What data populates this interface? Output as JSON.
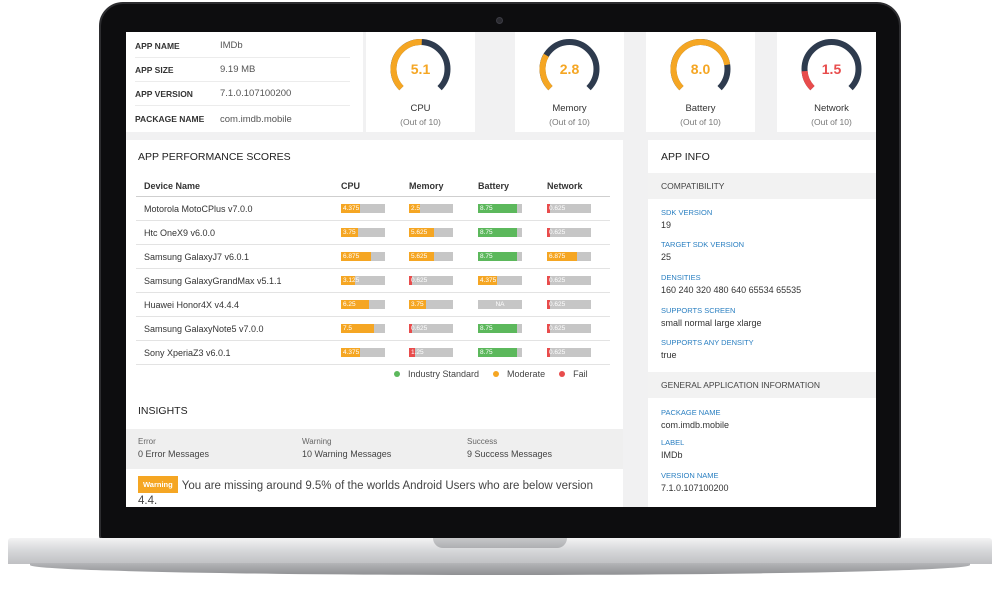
{
  "app_info": [
    {
      "key": "APP NAME",
      "value": "IMDb"
    },
    {
      "key": "APP SIZE",
      "value": "9.19 MB"
    },
    {
      "key": "APP VERSION",
      "value": "7.1.0.107100200"
    },
    {
      "key": "PACKAGE NAME",
      "value": "com.imdb.mobile"
    }
  ],
  "gauges": [
    {
      "label": "CPU",
      "value": "5.1",
      "score": 5.1,
      "sub": "(Out of 10)",
      "color": "#f5a623"
    },
    {
      "label": "Memory",
      "value": "2.8",
      "score": 2.8,
      "sub": "(Out of 10)",
      "color": "#f5a623"
    },
    {
      "label": "Battery",
      "value": "8.0",
      "score": 8.0,
      "sub": "(Out of 10)",
      "color": "#f5a623"
    },
    {
      "label": "Network",
      "value": "1.5",
      "score": 1.5,
      "sub": "(Out of 10)",
      "color": "#e84c4c"
    }
  ],
  "colors": {
    "green": "#5cb85c",
    "orange": "#f5a623",
    "red": "#e84c4c",
    "track": "#c6c6c6",
    "gauge_track": "#2e3b4e"
  },
  "performance": {
    "title": "APP PERFORMANCE SCORES",
    "columns": [
      "Device Name",
      "CPU",
      "Memory",
      "Battery",
      "Network"
    ],
    "rows": [
      {
        "device": "Motorola MotoCPlus v7.0.0",
        "scores": [
          [
            "4.375",
            "orange",
            0.44
          ],
          [
            "2.5",
            "orange",
            0.25
          ],
          [
            "8.75",
            "green",
            0.88
          ],
          [
            "0.625",
            "red",
            0.06
          ]
        ]
      },
      {
        "device": "Htc OneX9 v6.0.0",
        "scores": [
          [
            "3.75",
            "orange",
            0.38
          ],
          [
            "5.625",
            "orange",
            0.56
          ],
          [
            "8.75",
            "green",
            0.88
          ],
          [
            "0.625",
            "red",
            0.06
          ]
        ]
      },
      {
        "device": "Samsung GalaxyJ7 v6.0.1",
        "scores": [
          [
            "6.875",
            "orange",
            0.69
          ],
          [
            "5.625",
            "orange",
            0.56
          ],
          [
            "8.75",
            "green",
            0.88
          ],
          [
            "6.875",
            "orange",
            0.69
          ]
        ]
      },
      {
        "device": "Samsung GalaxyGrandMax v5.1.1",
        "scores": [
          [
            "3.125",
            "orange",
            0.31
          ],
          [
            "0.625",
            "red",
            0.06
          ],
          [
            "4.375",
            "orange",
            0.44
          ],
          [
            "0.625",
            "red",
            0.06
          ]
        ]
      },
      {
        "device": "Huawei Honor4X v4.4.4",
        "scores": [
          [
            "6.25",
            "orange",
            0.63
          ],
          [
            "3.75",
            "orange",
            0.38
          ],
          [
            "NA",
            "na",
            0
          ],
          [
            "0.625",
            "red",
            0.06
          ]
        ]
      },
      {
        "device": "Samsung GalaxyNote5 v7.0.0",
        "scores": [
          [
            "7.5",
            "orange",
            0.75
          ],
          [
            "0.625",
            "red",
            0.06
          ],
          [
            "8.75",
            "green",
            0.88
          ],
          [
            "0.625",
            "red",
            0.06
          ]
        ]
      },
      {
        "device": "Sony XperiaZ3 v6.0.1",
        "scores": [
          [
            "4.375",
            "orange",
            0.44
          ],
          [
            "1.25",
            "red",
            0.13
          ],
          [
            "8.75",
            "green",
            0.88
          ],
          [
            "0.625",
            "red",
            0.06
          ]
        ]
      }
    ],
    "legend": [
      {
        "label": "Industry Standard",
        "color": "#5cb85c"
      },
      {
        "label": "Moderate",
        "color": "#f5a623"
      },
      {
        "label": "Fail",
        "color": "#e84c4c"
      }
    ]
  },
  "insights": {
    "title": "INSIGHTS",
    "error_label": "Error",
    "error_value": "0 Error Messages",
    "warning_label": "Warning",
    "warning_value": "10 Warning Messages",
    "success_label": "Success",
    "success_value": "9 Success Messages",
    "badge": "Warning",
    "message": "You are missing around 9.5% of the worlds Android Users who are below version 4.4."
  },
  "sidebar": {
    "title": "APP INFO",
    "compat_title": "COMPATIBILITY",
    "sdk_version_label": "SDK VERSION",
    "sdk_version": "19",
    "target_sdk_label": "TARGET SDK VERSION",
    "target_sdk": "25",
    "densities_label": "DENSITIES",
    "densities": "160 240 320 480 640 65534 65535",
    "screens_label": "SUPPORTS SCREEN",
    "screens": "small normal large xlarge",
    "any_density_label": "SUPPORTS ANY DENSITY",
    "any_density": "true",
    "general_title": "GENERAL APPLICATION INFORMATION",
    "package_label": "PACKAGE NAME",
    "package": "com.imdb.mobile",
    "label_label": "LABEL",
    "label": "IMDb",
    "version_label": "VERSION NAME",
    "version": "7.1.0.107100200"
  }
}
